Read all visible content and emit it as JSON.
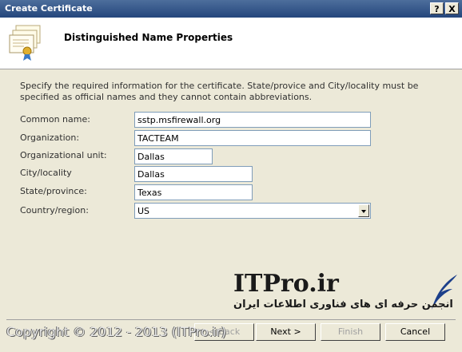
{
  "window": {
    "title": "Create Certificate",
    "help_label": "?",
    "close_label": "X"
  },
  "header": {
    "title": "Distinguished Name Properties",
    "icon": "certificate-icon"
  },
  "description": "Specify the required information for the certificate. State/provice and City/locality must be specified as official names and they cannot contain abbreviations.",
  "form": {
    "common_name": {
      "label": "Common name:",
      "value": "sstp.msfirewall.org"
    },
    "organization": {
      "label": "Organization:",
      "value": "TACTEAM"
    },
    "org_unit": {
      "label": "Organizational unit:",
      "value": "Dallas"
    },
    "city": {
      "label": "City/locality",
      "value": "Dallas"
    },
    "state": {
      "label": "State/province:",
      "value": "Texas"
    },
    "country": {
      "label": "Country/region:",
      "value": "US"
    }
  },
  "buttons": {
    "back": "< Back",
    "next": "Next >",
    "finish": "Finish",
    "cancel": "Cancel"
  },
  "watermark": {
    "brand": "ITPro.ir",
    "persian": "انجمن حرفه ای های فناوری اطلاعات ایران",
    "copyright": "Copyright © 2012 - 2013 (ITPro.ir)"
  }
}
